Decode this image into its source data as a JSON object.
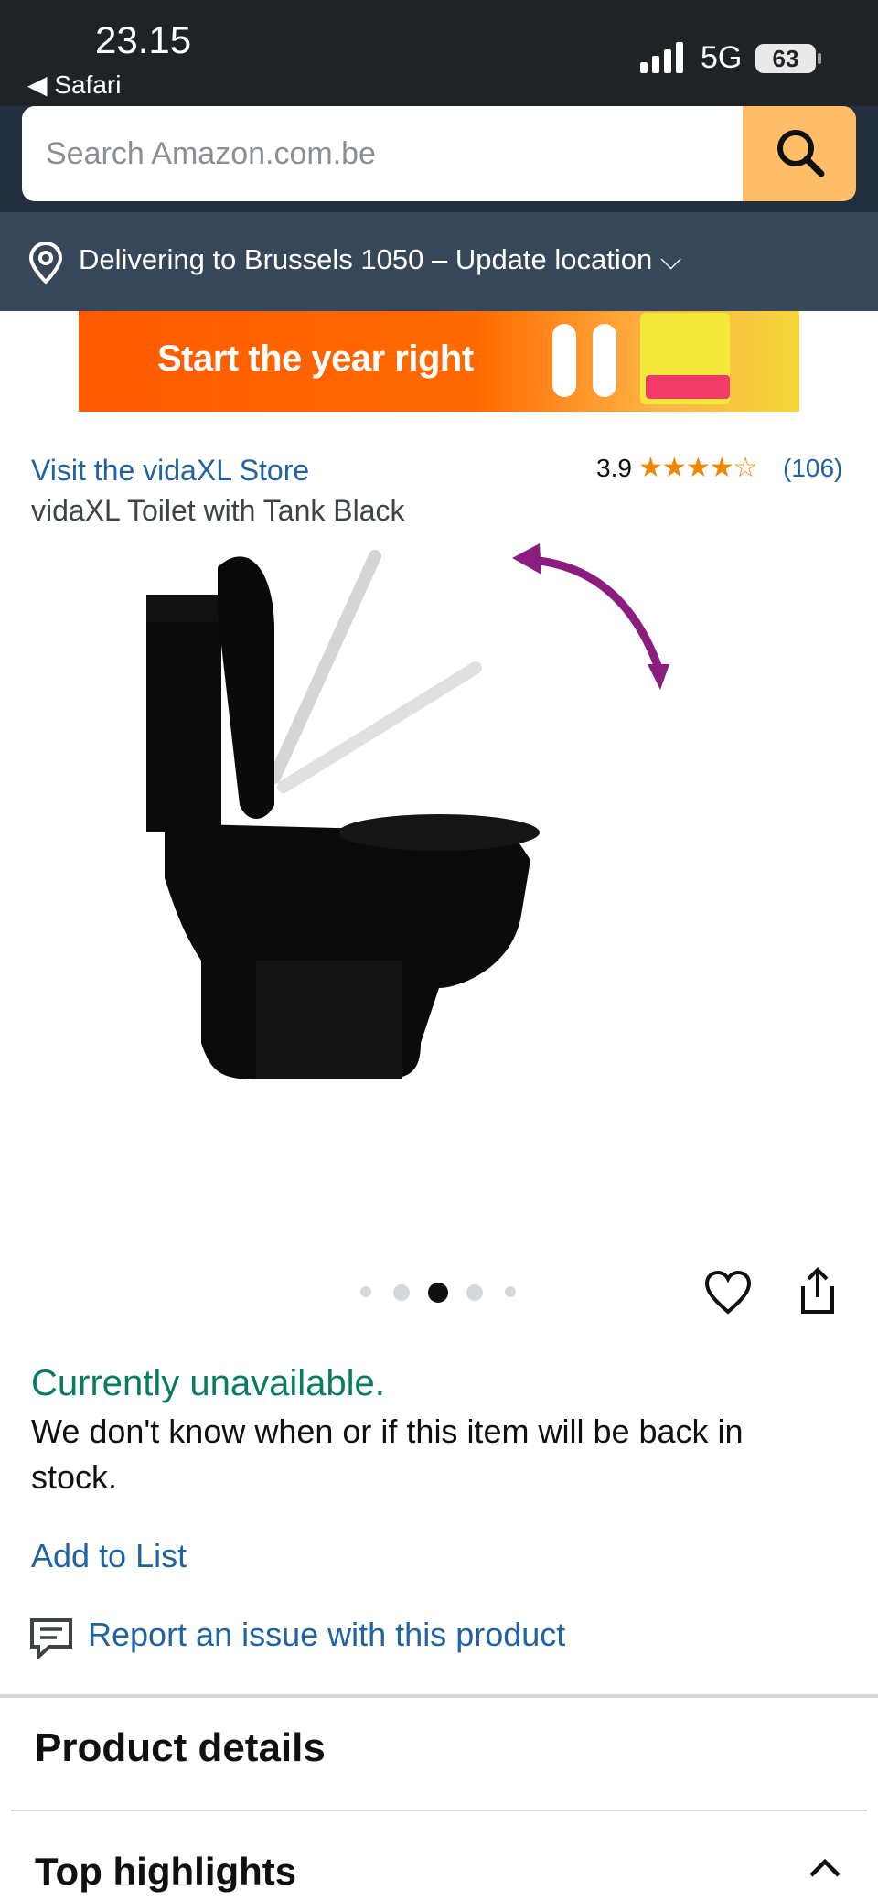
{
  "status_bar": {
    "time": "23.15",
    "back_app": "Safari",
    "network": "5G",
    "battery": "63"
  },
  "search": {
    "placeholder": "Search Amazon.com.be"
  },
  "delivery": {
    "text": "Delivering to Brussels 1050 – Update location ⌵"
  },
  "banner": {
    "text": "Start the year right"
  },
  "product": {
    "store_link": "Visit the vidaXL Store",
    "rating": "3.9",
    "stars_shown": 4,
    "rating_count": "(106)",
    "title": "vidaXL Toilet with Tank Black"
  },
  "carousel": {
    "dot_count": 5,
    "active_index": 2
  },
  "availability": {
    "status": "Currently unavailable.",
    "description": "We don't know when or if this item will be back in stock."
  },
  "actions": {
    "add_to_list": "Add to List",
    "report": "Report an issue with this product"
  },
  "sections": {
    "product_details": "Product details",
    "top_highlights": "Top highlights"
  },
  "colors": {
    "header_bg": "#232f3e",
    "deliver_bg": "#37475a",
    "search_btn": "#febd69",
    "link": "#2162a1",
    "available_green": "#067d62",
    "star": "#f08804"
  }
}
